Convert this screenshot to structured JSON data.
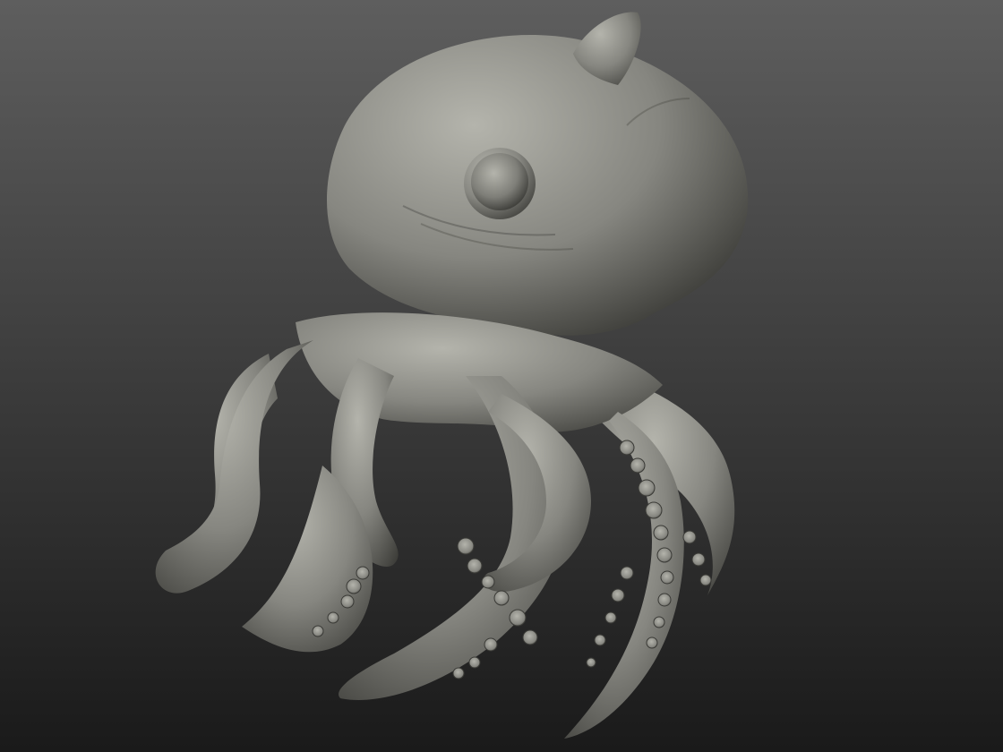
{
  "viewport": {
    "background_top": "#5e5e5e",
    "background_bottom": "#1a1a1a",
    "model": {
      "material_color": "#868680",
      "highlight_color": "#b4b4ac",
      "shadow_color": "#3a3a36",
      "eye_color": "#7e7e78"
    }
  }
}
